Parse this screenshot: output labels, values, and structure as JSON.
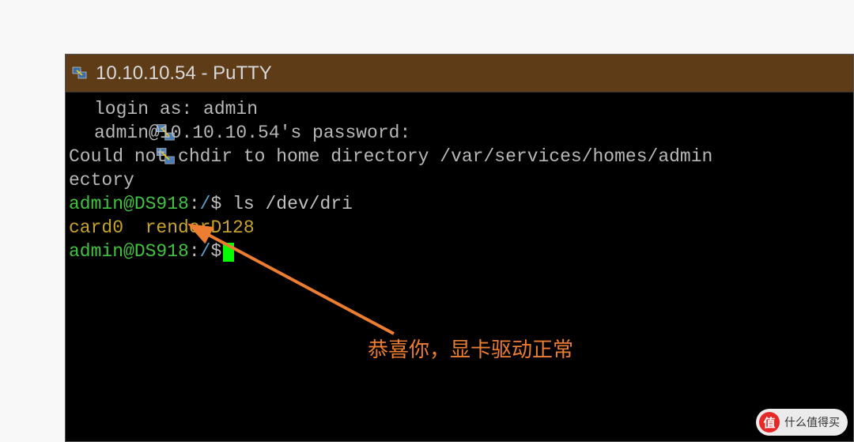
{
  "window": {
    "title": "10.10.10.54 - PuTTY"
  },
  "terminal": {
    "line1": "login as: admin",
    "line2": "admin@10.10.10.54's password:",
    "line3": "Could not chdir to home directory /var/services/homes/admin",
    "line4": "ectory",
    "prompt_user": "admin@DS918",
    "prompt_sep": ":",
    "prompt_path": "/",
    "prompt_sym": "$",
    "cmd1": " ls /dev/dri",
    "output_item1": "card0",
    "output_spacer": "  ",
    "output_item2": "renderD128"
  },
  "annotation": {
    "text": "恭喜你，显卡驱动正常"
  },
  "watermark": {
    "badge": "值",
    "text": "什么值得买"
  }
}
